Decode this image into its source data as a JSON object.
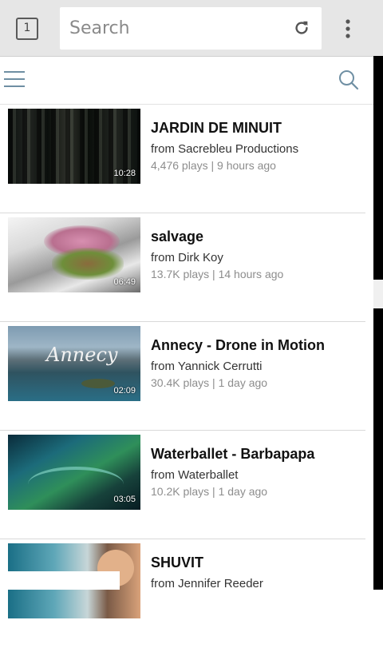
{
  "browser": {
    "tab_count": "1",
    "url_placeholder": "Search"
  },
  "videos": [
    {
      "title": "JARDIN DE MINUIT",
      "author": "from Sacrebleu Productions",
      "meta": "4,476 plays | 9 hours ago",
      "duration": "10:28"
    },
    {
      "title": "salvage",
      "author": "from Dirk Koy",
      "meta": "13.7K plays | 14 hours ago",
      "duration": "06:49"
    },
    {
      "title": "Annecy - Drone in Motion",
      "author": "from Yannick Cerrutti",
      "meta": "30.4K plays | 1 day ago",
      "duration": "02:09",
      "thumb_text": "Annecy"
    },
    {
      "title": "Waterballet - Barbapapa",
      "author": "from Waterballet",
      "meta": "10.2K plays | 1 day ago",
      "duration": "03:05"
    },
    {
      "title": "SHUVIT",
      "author": "from Jennifer Reeder",
      "meta": "",
      "duration": ""
    }
  ]
}
